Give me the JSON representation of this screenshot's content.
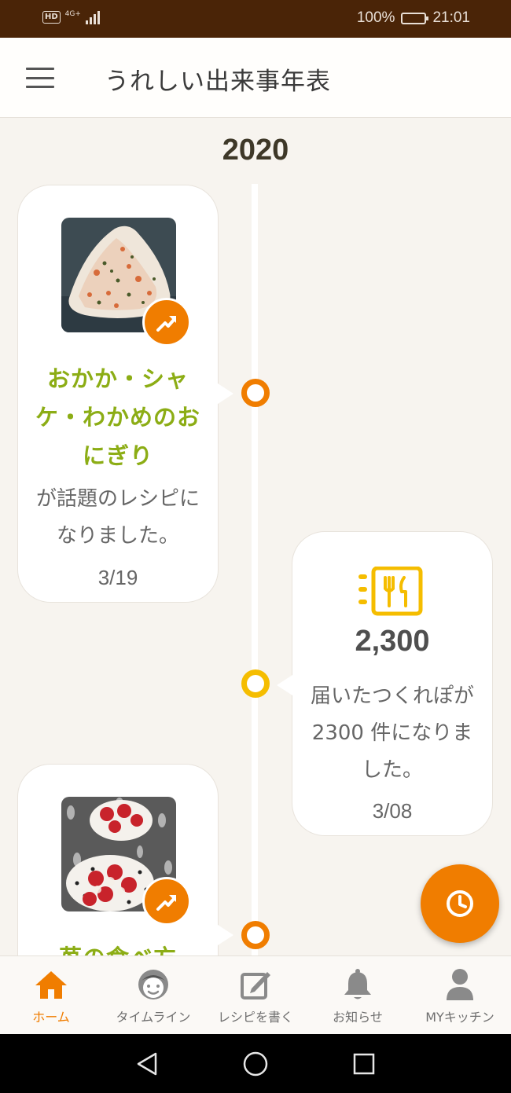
{
  "status_bar": {
    "hd": "HD",
    "network": "4G+",
    "battery": "100%",
    "battery_level": 1.0,
    "time": "21:01"
  },
  "app_bar": {
    "title": "うれしい出来事年表"
  },
  "timeline": {
    "year": "2020",
    "cards": [
      {
        "recipe_name": "おかか・シャケ・わかめのおにぎり",
        "text": "が話題のレシピになりました。",
        "date": "3/19"
      },
      {
        "count": "2,300",
        "text": "届いたつくれぽが 2300 件になりました。",
        "date": "3/08"
      },
      {
        "recipe_name": "苺の食べ方"
      }
    ]
  },
  "bottom_nav": {
    "items": [
      {
        "label": "ホーム",
        "icon": "home-icon",
        "active": true
      },
      {
        "label": "タイムライン",
        "icon": "face-icon",
        "active": false
      },
      {
        "label": "レシピを書く",
        "icon": "edit-icon",
        "active": false
      },
      {
        "label": "お知らせ",
        "icon": "bell-icon",
        "active": false
      },
      {
        "label": "MYキッチン",
        "icon": "person-icon",
        "active": false
      }
    ]
  },
  "colors": {
    "accent": "#f07d00",
    "status_bar": "#4a2407",
    "recipe_green": "#8cad15",
    "count_yellow": "#f5bd00",
    "background": "#f7f4ef"
  }
}
